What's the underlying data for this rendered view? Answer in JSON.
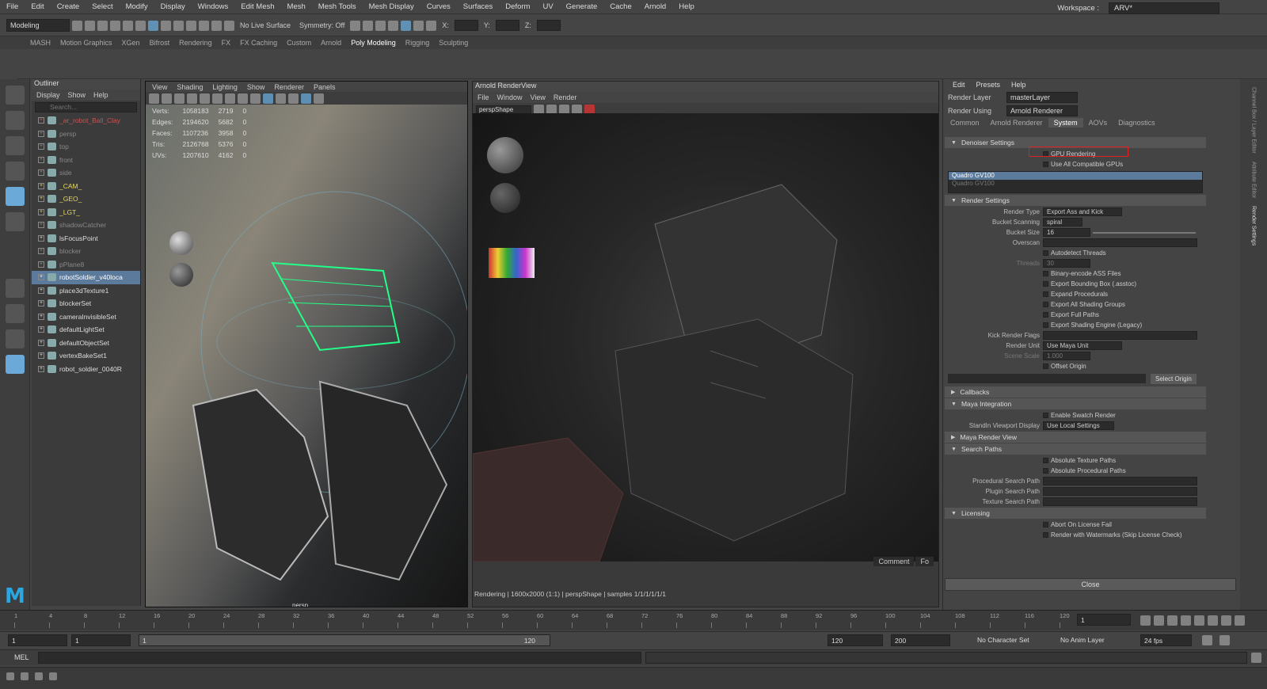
{
  "menubar": {
    "items": [
      "File",
      "Edit",
      "Create",
      "Select",
      "Modify",
      "Display",
      "Windows",
      "Edit Mesh",
      "Mesh",
      "Mesh Tools",
      "Mesh Display",
      "Curves",
      "Surfaces",
      "Deform",
      "UV",
      "Generate",
      "Cache",
      "Arnold",
      "Help"
    ],
    "workspace_label": "Workspace :",
    "workspace_value": "ARV*"
  },
  "toolbar": {
    "mode": "Modeling",
    "live_surface": "No Live Surface",
    "symmetry": "Symmetry: Off",
    "x": "X:",
    "y": "Y:",
    "z": "Z:"
  },
  "shelf": {
    "tabs": [
      "MASH",
      "Motion Graphics",
      "XGen",
      "Bifrost",
      "Rendering",
      "FX",
      "FX Caching",
      "Custom",
      "Arnold",
      "Poly Modeling",
      "Rigging",
      "Sculpting"
    ],
    "active": "Poly Modeling"
  },
  "outliner": {
    "title": "Outliner",
    "menu": [
      "Display",
      "Show",
      "Help"
    ],
    "search_placeholder": "Search...",
    "items": [
      {
        "label": "_ar_robot_Ball_Clay",
        "style": "r"
      },
      {
        "label": "persp",
        "style": ""
      },
      {
        "label": "top",
        "style": ""
      },
      {
        "label": "front",
        "style": ""
      },
      {
        "label": "side",
        "style": ""
      },
      {
        "label": "_CAM_",
        "style": "y"
      },
      {
        "label": "_GEO_",
        "style": "y"
      },
      {
        "label": "_LGT_",
        "style": "y"
      },
      {
        "label": "shadowCatcher",
        "style": ""
      },
      {
        "label": "lsFocusPoint",
        "style": "w"
      },
      {
        "label": "blocker",
        "style": ""
      },
      {
        "label": "pPlane8",
        "style": ""
      },
      {
        "label": "robotSoldier_v40loca",
        "style": "sel"
      },
      {
        "label": "place3dTexture1",
        "style": "w"
      },
      {
        "label": "blockerSet",
        "style": "w"
      },
      {
        "label": "cameraInvisibleSet",
        "style": "w"
      },
      {
        "label": "defaultLightSet",
        "style": "w"
      },
      {
        "label": "defaultObjectSet",
        "style": "w"
      },
      {
        "label": "vertexBakeSet1",
        "style": "w"
      },
      {
        "label": "robot_soldier_0040R",
        "style": "w"
      }
    ]
  },
  "viewport": {
    "menu": [
      "View",
      "Shading",
      "Lighting",
      "Show",
      "Renderer",
      "Panels"
    ],
    "hud": [
      {
        "label": "Verts:",
        "a": "1058183",
        "b": "2719",
        "c": "0"
      },
      {
        "label": "Edges:",
        "a": "2194620",
        "b": "5682",
        "c": "0"
      },
      {
        "label": "Faces:",
        "a": "1107236",
        "b": "3958",
        "c": "0"
      },
      {
        "label": "Tris:",
        "a": "2126768",
        "b": "5376",
        "c": "0"
      },
      {
        "label": "UVs:",
        "a": "1207610",
        "b": "4162",
        "c": "0"
      }
    ],
    "camera": "persp"
  },
  "renderview": {
    "title": "Arnold RenderView",
    "menu": [
      "File",
      "Window",
      "View",
      "Render"
    ],
    "camera": "perspShape",
    "status": "Rendering | 1600x2000 (1:1) | perspShape | samples 1/1/1/1/1/1",
    "tabs": [
      "Comment",
      "Fo"
    ]
  },
  "render_settings": {
    "menu": [
      "Edit",
      "Presets",
      "Help"
    ],
    "render_layer_label": "Render Layer",
    "render_layer": "masterLayer",
    "render_using_label": "Render Using",
    "render_using": "Arnold Renderer",
    "tabs": [
      "Common",
      "Arnold Renderer",
      "System",
      "AOVs",
      "Diagnostics"
    ],
    "active_tab": "System",
    "denoiser": {
      "title": "Denoiser Settings",
      "gpu_rendering": "GPU Rendering",
      "use_all": "Use All Compatible GPUs",
      "gpu_selected": "Quadro GV100",
      "gpu_other": "Quadro GV100"
    },
    "render": {
      "title": "Render Settings",
      "render_type_label": "Render Type",
      "render_type": "Export Ass and Kick",
      "bucket_scanning_label": "Bucket Scanning",
      "bucket_scanning": "spiral",
      "bucket_size_label": "Bucket Size",
      "bucket_size": "16",
      "overscan_label": "Overscan",
      "autodetect": "Autodetect Threads",
      "threads_label": "Threads",
      "threads": "30",
      "binary": "Binary-encode ASS Files",
      "bbox": "Export Bounding Box (.asstoc)",
      "procedurals": "Expand Procedurals",
      "shading_groups": "Export All Shading Groups",
      "full_paths": "Export Full Paths",
      "shading_engine": "Export Shading Engine (Legacy)",
      "kick_flags_label": "Kick Render Flags",
      "render_unit_label": "Render Unit",
      "render_unit": "Use Maya Unit",
      "scene_scale_label": "Scene Scale",
      "scene_scale": "1.000",
      "offset_origin": "Offset Origin",
      "select_origin": "Select Origin"
    },
    "callbacks": "Callbacks",
    "maya_integration": {
      "title": "Maya Integration",
      "swatch": "Enable Swatch Render",
      "standin_label": "StandIn Viewport Display",
      "standin": "Use Local Settings"
    },
    "maya_render_view": "Maya Render View",
    "search_paths": {
      "title": "Search Paths",
      "abs_tex": "Absolute Texture Paths",
      "abs_proc": "Absolute Procedural Paths",
      "proc_label": "Procedural Search Path",
      "plugin_label": "Plugin Search Path",
      "texture_label": "Texture Search Path"
    },
    "licensing": {
      "title": "Licensing",
      "abort": "Abort On License Fail",
      "watermarks": "Render with Watermarks (Skip License Check)"
    },
    "close": "Close"
  },
  "right_strip": [
    "Channel Box / Layer Editor",
    "Attribute Editor",
    "Render Settings"
  ],
  "timeline": {
    "ticks": [
      "1",
      "4",
      "8",
      "12",
      "16",
      "20",
      "24",
      "28",
      "32",
      "36",
      "40",
      "44",
      "48",
      "52",
      "56",
      "60",
      "64",
      "68",
      "72",
      "76",
      "80",
      "84",
      "88",
      "92",
      "96",
      "100",
      "104",
      "108",
      "112",
      "116",
      "120"
    ],
    "current": "1"
  },
  "range": {
    "start": "1",
    "anim_start": "1",
    "slider_start": "1",
    "slider_end": "120",
    "end": "120",
    "anim_end": "200",
    "character_set": "No Character Set",
    "anim_layer": "No Anim Layer",
    "fps": "24 fps"
  },
  "cmdline": {
    "label": "MEL"
  },
  "colors": {
    "accent": "#6aa9d8",
    "selection": "#5c7a9c",
    "highlight_box": "#e02020",
    "maya_logo": "#2aa7e0"
  }
}
